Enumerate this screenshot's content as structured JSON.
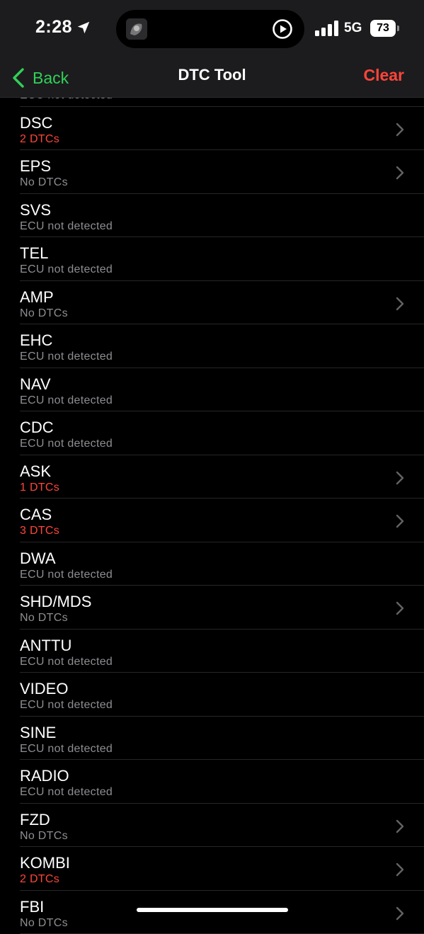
{
  "status": {
    "time": "2:28",
    "network": "5G",
    "battery": "73"
  },
  "nav": {
    "back_label": "Back",
    "title": "DTC Tool",
    "clear_label": "Clear"
  },
  "colors": {
    "accent_green": "#30d158",
    "destructive_red": "#ff453a",
    "secondary_text": "#8e8e93"
  },
  "modules": [
    {
      "name": "",
      "status": "ECU not detected",
      "warn": false,
      "chevron": false
    },
    {
      "name": "DSC",
      "status": "2 DTCs",
      "warn": true,
      "chevron": true
    },
    {
      "name": "EPS",
      "status": "No DTCs",
      "warn": false,
      "chevron": true
    },
    {
      "name": "SVS",
      "status": "ECU not detected",
      "warn": false,
      "chevron": false
    },
    {
      "name": "TEL",
      "status": "ECU not detected",
      "warn": false,
      "chevron": false
    },
    {
      "name": "AMP",
      "status": "No DTCs",
      "warn": false,
      "chevron": true
    },
    {
      "name": "EHC",
      "status": "ECU not detected",
      "warn": false,
      "chevron": false
    },
    {
      "name": "NAV",
      "status": "ECU not detected",
      "warn": false,
      "chevron": false
    },
    {
      "name": "CDC",
      "status": "ECU not detected",
      "warn": false,
      "chevron": false
    },
    {
      "name": "ASK",
      "status": "1 DTCs",
      "warn": true,
      "chevron": true
    },
    {
      "name": "CAS",
      "status": "3 DTCs",
      "warn": true,
      "chevron": true
    },
    {
      "name": "DWA",
      "status": "ECU not detected",
      "warn": false,
      "chevron": false
    },
    {
      "name": "SHD/MDS",
      "status": "No DTCs",
      "warn": false,
      "chevron": true
    },
    {
      "name": "ANTTU",
      "status": "ECU not detected",
      "warn": false,
      "chevron": false
    },
    {
      "name": "VIDEO",
      "status": "ECU not detected",
      "warn": false,
      "chevron": false
    },
    {
      "name": "SINE",
      "status": "ECU not detected",
      "warn": false,
      "chevron": false
    },
    {
      "name": "RADIO",
      "status": "ECU not detected",
      "warn": false,
      "chevron": false
    },
    {
      "name": "FZD",
      "status": "No DTCs",
      "warn": false,
      "chevron": true
    },
    {
      "name": "KOMBI",
      "status": "2 DTCs",
      "warn": true,
      "chevron": true
    },
    {
      "name": "FBI",
      "status": "No DTCs",
      "warn": false,
      "chevron": true
    }
  ]
}
